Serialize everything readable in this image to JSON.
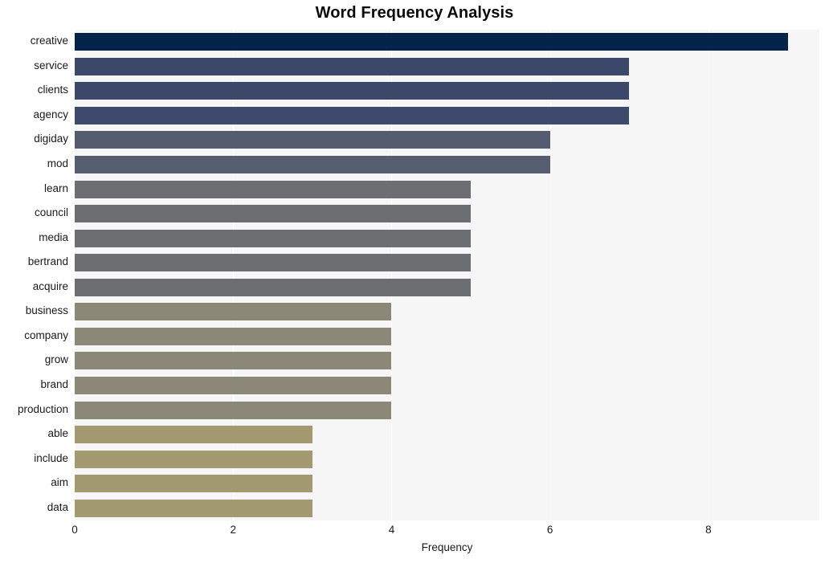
{
  "chart_data": {
    "type": "bar",
    "orientation": "horizontal",
    "title": "Word Frequency Analysis",
    "xlabel": "Frequency",
    "ylabel": "",
    "xlim": [
      0,
      9.4
    ],
    "xticks": [
      0,
      2,
      4,
      6,
      8
    ],
    "xticklabels": [
      "0",
      "2",
      "4",
      "6",
      "8"
    ],
    "grid": true,
    "grid_axis": "x",
    "legend": false,
    "plot_background": "#f6f6f7",
    "figure_background": "#ffffff",
    "categories": [
      "creative",
      "service",
      "clients",
      "agency",
      "digiday",
      "mod",
      "learn",
      "council",
      "media",
      "bertrand",
      "acquire",
      "business",
      "company",
      "grow",
      "brand",
      "production",
      "able",
      "include",
      "aim",
      "data"
    ],
    "values": [
      9,
      7,
      7,
      7,
      6,
      6,
      5,
      5,
      5,
      5,
      5,
      4,
      4,
      4,
      4,
      4,
      3,
      3,
      3,
      3
    ],
    "bar_colors": [
      "#04234b",
      "#3b4869",
      "#3c486a",
      "#3d4a6c",
      "#565c70",
      "#575d71",
      "#6d6e71",
      "#6d6e71",
      "#6d6e71",
      "#6d6e71",
      "#6d6e71",
      "#8b8877",
      "#8b8877",
      "#8b8877",
      "#8b8877",
      "#8b8877",
      "#a39a72",
      "#a39a72",
      "#a39a72",
      "#a39a72"
    ],
    "bars": [
      {
        "label": "creative",
        "value": 9,
        "color": "#04234b"
      },
      {
        "label": "service",
        "value": 7,
        "color": "#3b4869"
      },
      {
        "label": "clients",
        "value": 7,
        "color": "#3c486a"
      },
      {
        "label": "agency",
        "value": 7,
        "color": "#3d4a6c"
      },
      {
        "label": "digiday",
        "value": 6,
        "color": "#565c70"
      },
      {
        "label": "mod",
        "value": 6,
        "color": "#575d71"
      },
      {
        "label": "learn",
        "value": 5,
        "color": "#6d6e71"
      },
      {
        "label": "council",
        "value": 5,
        "color": "#6d6e71"
      },
      {
        "label": "media",
        "value": 5,
        "color": "#6d6e71"
      },
      {
        "label": "bertrand",
        "value": 5,
        "color": "#6d6e71"
      },
      {
        "label": "acquire",
        "value": 5,
        "color": "#6d6e71"
      },
      {
        "label": "business",
        "value": 4,
        "color": "#8b8877"
      },
      {
        "label": "company",
        "value": 4,
        "color": "#8b8877"
      },
      {
        "label": "grow",
        "value": 4,
        "color": "#8b8877"
      },
      {
        "label": "brand",
        "value": 4,
        "color": "#8b8877"
      },
      {
        "label": "production",
        "value": 4,
        "color": "#8b8877"
      },
      {
        "label": "able",
        "value": 3,
        "color": "#a39a72"
      },
      {
        "label": "include",
        "value": 3,
        "color": "#a39a72"
      },
      {
        "label": "aim",
        "value": 3,
        "color": "#a39a72"
      },
      {
        "label": "data",
        "value": 3,
        "color": "#a39a72"
      }
    ]
  }
}
